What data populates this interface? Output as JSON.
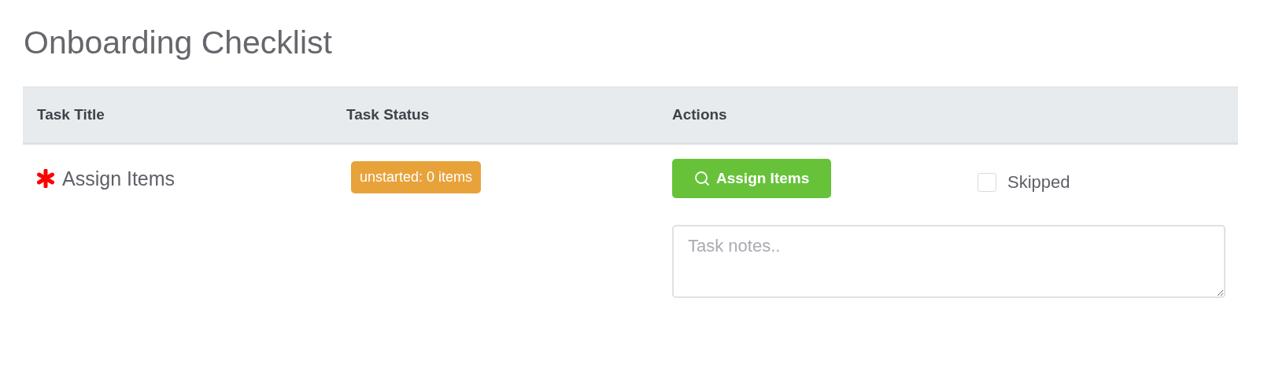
{
  "title": "Onboarding Checklist",
  "table": {
    "columns": [
      "Task Title",
      "Task Status",
      "Actions"
    ],
    "rows": [
      {
        "title": "Assign Items",
        "required": true,
        "status": "unstarted: 0 items",
        "action": "Assign Items",
        "skipped": {
          "label": "Skipped",
          "checked": false
        },
        "notes": {
          "placeholder": "Task notes.."
        }
      }
    ]
  }
}
